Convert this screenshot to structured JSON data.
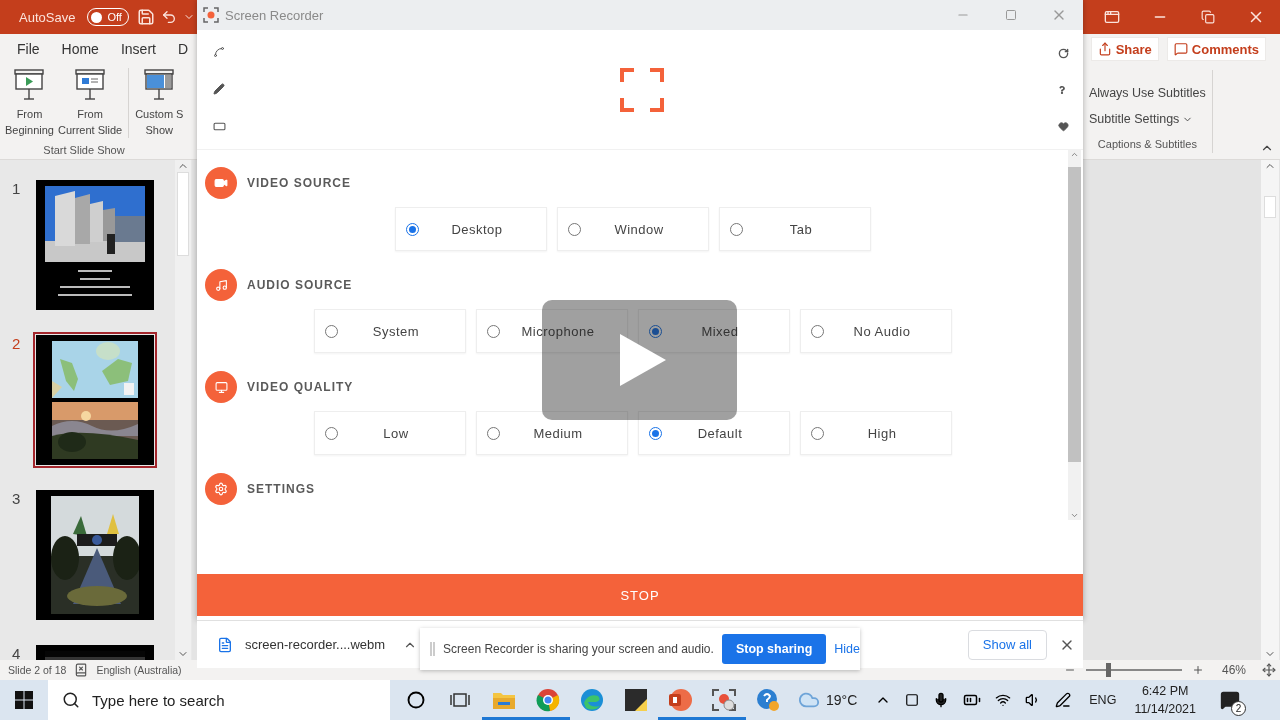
{
  "powerpoint": {
    "autosave": {
      "label": "AutoSave",
      "toggle": "Off",
      "on": false
    },
    "tabs": [
      {
        "label": "File"
      },
      {
        "label": "Home"
      },
      {
        "label": "Insert"
      },
      {
        "label": "D"
      }
    ],
    "share_button": "Share",
    "comments_button": "Comments",
    "ribbon_left": {
      "buttons": [
        {
          "kind": "beginning",
          "lines": [
            "From",
            "Beginning"
          ]
        },
        {
          "kind": "current",
          "lines": [
            "From",
            "Current Slide"
          ]
        },
        {
          "kind": "custom",
          "lines": [
            "Custom S",
            "Show"
          ]
        }
      ],
      "group_label": "Start Slide Show"
    },
    "ribbon_right": {
      "items": [
        "Always Use Subtitles",
        "Subtitle Settings"
      ],
      "group_label": "Captions & Subtitles"
    },
    "slides": [
      {
        "number": "1",
        "selected": false,
        "kind": "building"
      },
      {
        "number": "2",
        "selected": true,
        "kind": "map"
      },
      {
        "number": "3",
        "selected": false,
        "kind": "monument"
      },
      {
        "number": "4",
        "selected": false,
        "kind": "dark"
      }
    ],
    "status_bar": {
      "slide": "Slide 2 of 18",
      "language": "English (Australia)",
      "zoom": {
        "level": 0.21
      },
      "zoom_percent": "46%"
    }
  },
  "recorder": {
    "title": "Screen Recorder",
    "sections": [
      {
        "kind": "video",
        "title": "VIDEO SOURCE",
        "options": [
          {
            "label": "Desktop",
            "selected": true
          },
          {
            "label": "Window",
            "selected": false
          },
          {
            "label": "Tab",
            "selected": false
          }
        ]
      },
      {
        "kind": "audio",
        "title": "AUDIO SOURCE",
        "options": [
          {
            "label": "System",
            "selected": false
          },
          {
            "label": "Microphone",
            "selected": false
          },
          {
            "label": "Mixed",
            "selected": true
          },
          {
            "label": "No Audio",
            "selected": false
          }
        ]
      },
      {
        "kind": "quality",
        "title": "VIDEO QUALITY",
        "options": [
          {
            "label": "Low",
            "selected": false
          },
          {
            "label": "Medium",
            "selected": false
          },
          {
            "label": "Default",
            "selected": true
          },
          {
            "label": "High",
            "selected": false
          }
        ]
      },
      {
        "kind": "settings",
        "title": "SETTINGS"
      }
    ],
    "stop": "STOP"
  },
  "download_bar": {
    "file": "screen-recorder....webm",
    "show_all": "Show all"
  },
  "sharing": {
    "message": "Screen Recorder is sharing your screen and audio.",
    "stop": "Stop sharing",
    "hide": "Hide"
  },
  "taskbar": {
    "search_placeholder": "Type here to search",
    "apps": [
      {
        "kind": "explorer",
        "running": true
      },
      {
        "kind": "chrome",
        "running": true
      },
      {
        "kind": "edge",
        "running": false
      },
      {
        "kind": "notes",
        "running": false
      },
      {
        "kind": "powerpoint",
        "running": true
      },
      {
        "kind": "recorder",
        "running": true
      },
      {
        "kind": "help",
        "running": false
      }
    ],
    "temperature": "19°C",
    "language": "ENG",
    "time": "6:42 PM",
    "date": "11/14/2021",
    "notifications": "2"
  }
}
